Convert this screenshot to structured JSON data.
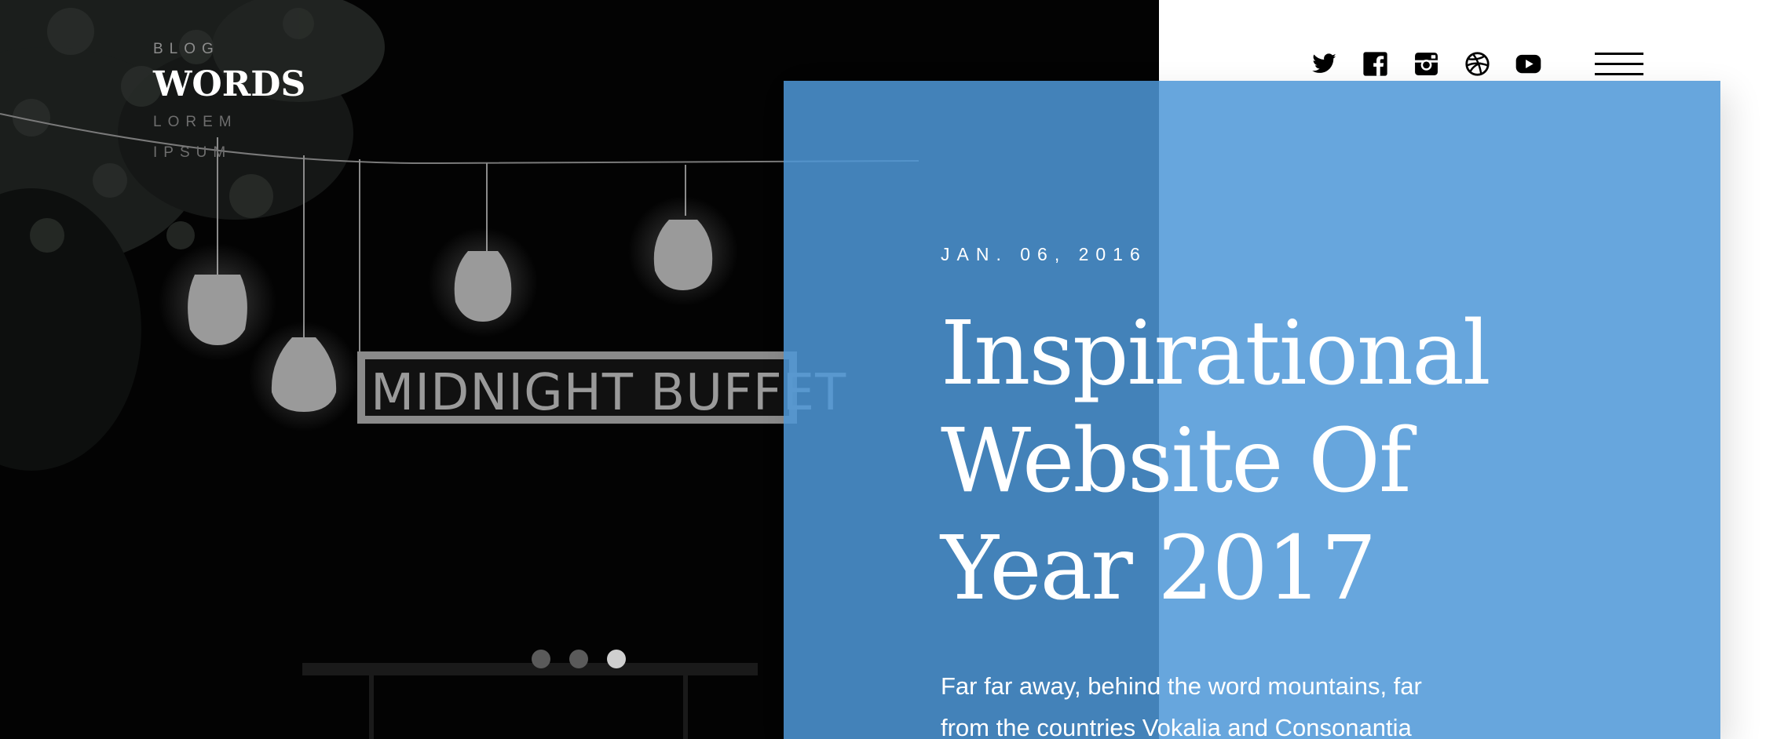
{
  "logo": {
    "top": "BLOG",
    "main": "WORDS",
    "sub_line1": "LOREM",
    "sub_line2": "IPSUM"
  },
  "hero": {
    "sign_text": "MIDNIGHT BUFFET"
  },
  "slider": {
    "count": 3,
    "active_index": 2
  },
  "nav": {
    "social": [
      "twitter-icon",
      "facebook-icon",
      "instagram-icon",
      "dribbble-icon",
      "youtube-icon"
    ],
    "menu": "hamburger-menu-icon"
  },
  "post": {
    "date": "JAN. 06, 2016",
    "title_line1": "Inspirational",
    "title_line2": "Website Of",
    "title_line3": "Year 2017",
    "excerpt_line1": "Far far away, behind the word mountains, far",
    "excerpt_line2": "from the countries Vokalia and Consonantia"
  },
  "colors": {
    "card_blue": "#4e97d7",
    "hero_bg": "#030303",
    "dot_active": "#cfcfcf",
    "dot_inactive": "#5a5a5a"
  }
}
